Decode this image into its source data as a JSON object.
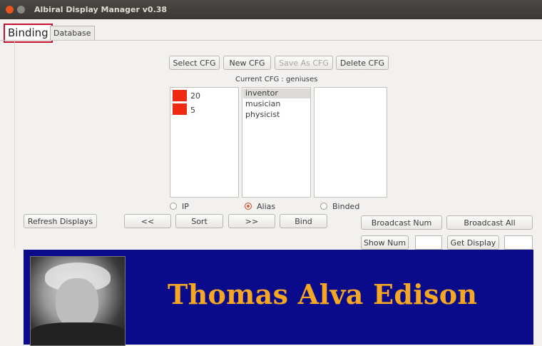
{
  "window": {
    "title": "Albiral Display Manager v0.38"
  },
  "tabs": [
    {
      "label": "Binding"
    },
    {
      "label": "Database"
    }
  ],
  "toolbar": {
    "select_cfg": "Select CFG",
    "new_cfg": "New CFG",
    "save_as_cfg": "Save As CFG",
    "delete_cfg": "Delete CFG"
  },
  "current_cfg": "Current CFG : geniuses",
  "displays_list": [
    {
      "label": "20",
      "color": "#ee2b10"
    },
    {
      "label": "5",
      "color": "#ee2b10"
    }
  ],
  "alias_list": [
    {
      "label": "inventor",
      "selected": true
    },
    {
      "label": "musician"
    },
    {
      "label": "physicist"
    }
  ],
  "sort_mode": {
    "ip": "IP",
    "alias": "Alias",
    "binded": "Binded",
    "selected": "Alias"
  },
  "actions": {
    "refresh_displays": "Refresh Displays",
    "prev": "<<",
    "sort": "Sort",
    "next": ">>",
    "bind": "Bind",
    "broadcast_num": "Broadcast Num",
    "broadcast_all": "Broadcast All",
    "show_num": "Show Num",
    "get_display": "Get Display"
  },
  "display_preview": {
    "name": "Thomas Alva Edison",
    "background": "#0a0b8a",
    "text_color": "#f5a623"
  }
}
